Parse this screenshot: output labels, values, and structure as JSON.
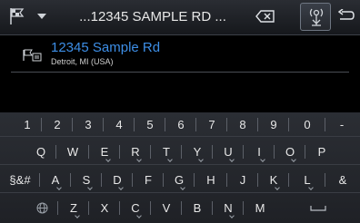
{
  "topbar": {
    "flag_icon": "flag-icon",
    "dropdown_icon": "chevron-down-icon",
    "destination_value": "...12345 SAMPLE RD ...",
    "backspace_icon": "backspace-icon",
    "voice_icon": "voice-destination-icon",
    "back_icon": "back-arrow-icon"
  },
  "result": {
    "icon": "destination-flag-icon",
    "title": "12345 Sample Rd",
    "subtitle": "Detroit, MI (USA)"
  },
  "keyboard": {
    "rows": [
      [
        "1",
        "2",
        "3",
        "4",
        "5",
        "6",
        "7",
        "8",
        "9",
        "0",
        "-"
      ],
      [
        "Q",
        "W",
        "E",
        "R",
        "T",
        "Y",
        "U",
        "I",
        "O",
        "P"
      ],
      [
        "§&#",
        "A",
        "S",
        "D",
        "F",
        "G",
        "H",
        "J",
        "K",
        "L",
        "&"
      ],
      [
        "Z",
        "X",
        "C",
        "V",
        "B",
        "N",
        "M"
      ]
    ],
    "globe_icon": "globe-icon",
    "space_icon": "space-bar-icon"
  },
  "colors": {
    "accent_blue": "#3d8ee6",
    "background": "#000000",
    "keyboard_bg": "#25282e"
  }
}
